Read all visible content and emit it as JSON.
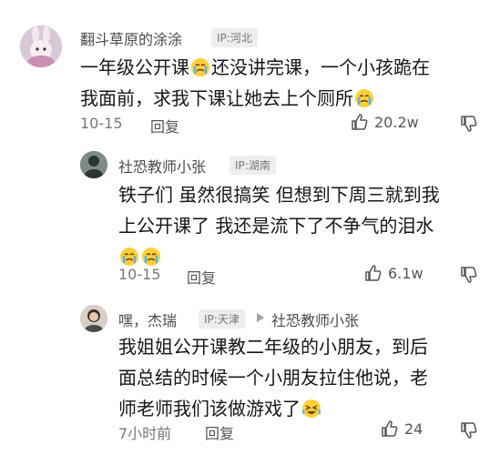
{
  "comments": [
    {
      "user": "翻斗草原的涂涂",
      "ip": "IP:河北",
      "text_parts": [
        "一年级公开课",
        "还没讲完课，一个小孩跪在",
        "我面前，求我下课让她去上个厕所"
      ],
      "date": "10-15",
      "reply_label": "回复",
      "likes": "20.2w"
    },
    {
      "user": "社恐教师小张",
      "ip": "IP:湖南",
      "text_line1": "铁子们 虽然很搞笑 但想到下周三就到我",
      "text_line2": "上公开课了 我还是流下了不争气的泪水",
      "date": "10-15",
      "reply_label": "回复",
      "likes": "6.1w"
    },
    {
      "user": "嘿，杰瑞",
      "ip": "IP:天津",
      "reply_to": "社恐教师小张",
      "text_line1": "我姐姐公开课教二年级的小朋友，到后",
      "text_line2": "面总结的时候一个小朋友拉住他说，老",
      "text_line3": "师老师我们该做游戏了",
      "date": "7小时前",
      "reply_label": "回复",
      "likes": "24"
    }
  ],
  "icons": {
    "like": "thumb-up-icon",
    "dislike": "thumb-down-icon",
    "crying": "crying-face-emoji"
  }
}
